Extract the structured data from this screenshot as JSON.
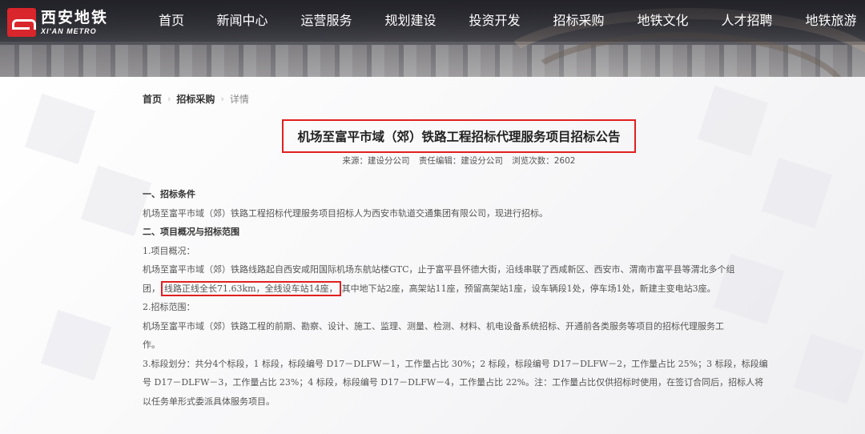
{
  "header": {
    "logo_cn": "西安地铁",
    "logo_en": "XI'AN METRO",
    "nav": [
      "首页",
      "新闻中心",
      "运营服务",
      "规划建设",
      "投资开发",
      "招标采购",
      "地铁文化",
      "人才招聘",
      "地铁旅游"
    ]
  },
  "breadcrumb": {
    "home": "首页",
    "section": "招标采购",
    "current": "详情"
  },
  "article": {
    "title": "机场至富平市域（郊）铁路工程招标代理服务项目招标公告",
    "meta": {
      "source": "来源：建设分公司",
      "editor": "责任编辑：建设分公司",
      "views": "浏览次数：2602"
    },
    "h1": "一、招标条件",
    "p1": "机场至富平市域（郊）铁路工程招标代理服务项目招标人为西安市轨道交通集团有限公司，现进行招标。",
    "h2": "二、项目概况与招标范围",
    "s1": "1.项目概况：",
    "p2_line1": "机场至富平市域（郊）铁路线路起自西安咸阳国际机场东航站楼GTC，止于富平县怀德大街，沿线串联了西咸新区、西安市、渭南市富平县等渭北多个组",
    "p2_line2_pre": "团，",
    "p2_line2_hl": "线路正线全长71.63km，全线设车站14座，",
    "p2_line2_post": "其中地下站2座，高架站11座，预留高架站1座，设车辆段1处，停车场1处，新建主变电站3座。",
    "s2": "2.招标范围：",
    "p3_line1": "机场至富平市域（郊）铁路工程的前期、勘察、设计、施工、监理、测量、检测、材料、机电设备系统招标、开通前各类服务等项目的招标代理服务工",
    "p3_line2": "作。",
    "p4_line1": "3.标段划分：共分4个标段，1 标段，标段编号 D17－DLFW－1，工作量占比 30%；2 标段，标段编号 D17－DLFW－2，工作量占比 25%；3 标段，标段编",
    "p4_line2": "号 D17－DLFW－3，工作量占比 23%；4 标段，标段编号 D17－DLFW－4，工作量占比 22%。注：工作量占比仅供招标时使用，在签订合同后，招标人将",
    "p4_line3": "以任务单形式委派具体服务项目。"
  }
}
